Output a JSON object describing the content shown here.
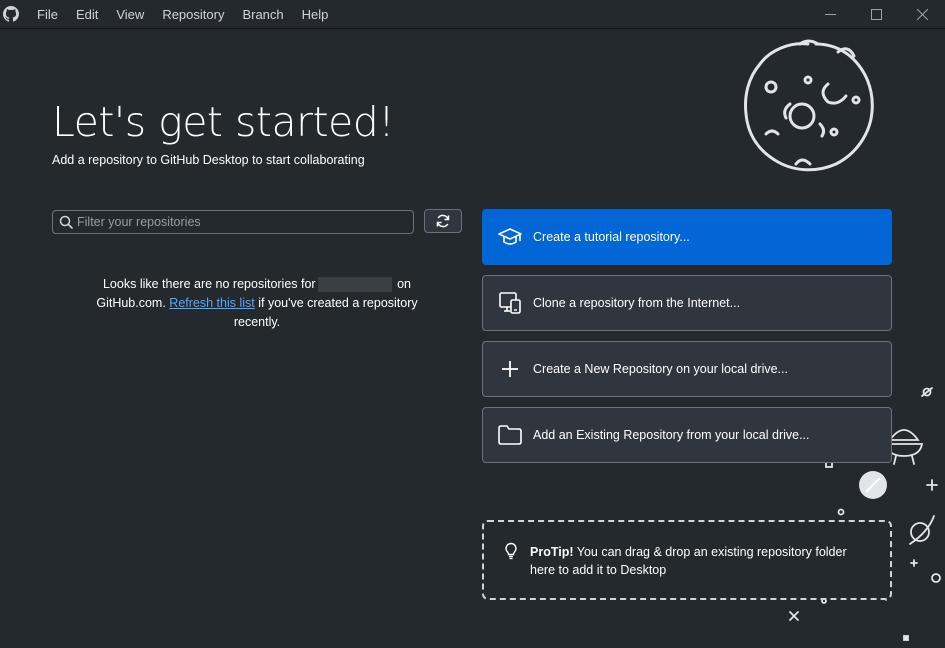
{
  "menubar": {
    "items": [
      "File",
      "Edit",
      "View",
      "Repository",
      "Branch",
      "Help"
    ]
  },
  "main": {
    "heading": "Let's get started!",
    "subheading": "Add a repository to GitHub Desktop to start collaborating",
    "filter": {
      "placeholder": "Filter your repositories"
    },
    "no_repos": {
      "text_before": "Looks like there are no repositories for",
      "text_on": "on",
      "text_host": "GitHub.com.",
      "link": "Refresh this list",
      "text_after": "if you've created a repository recently."
    }
  },
  "actions": [
    {
      "label": "Create a tutorial repository...",
      "icon": "mortarboard-icon"
    },
    {
      "label": "Clone a repository from the Internet...",
      "icon": "device-desktop-icon"
    },
    {
      "label": "Create a New Repository on your local drive...",
      "icon": "plus-icon"
    },
    {
      "label": "Add an Existing Repository from your local drive...",
      "icon": "folder-icon"
    }
  ],
  "protip": {
    "bold": "ProTip!",
    "text": "You can drag & drop an existing repository folder here to add it to Desktop"
  },
  "colors": {
    "background": "#24292e",
    "primary": "#0366d6",
    "link": "#58a6ff"
  }
}
